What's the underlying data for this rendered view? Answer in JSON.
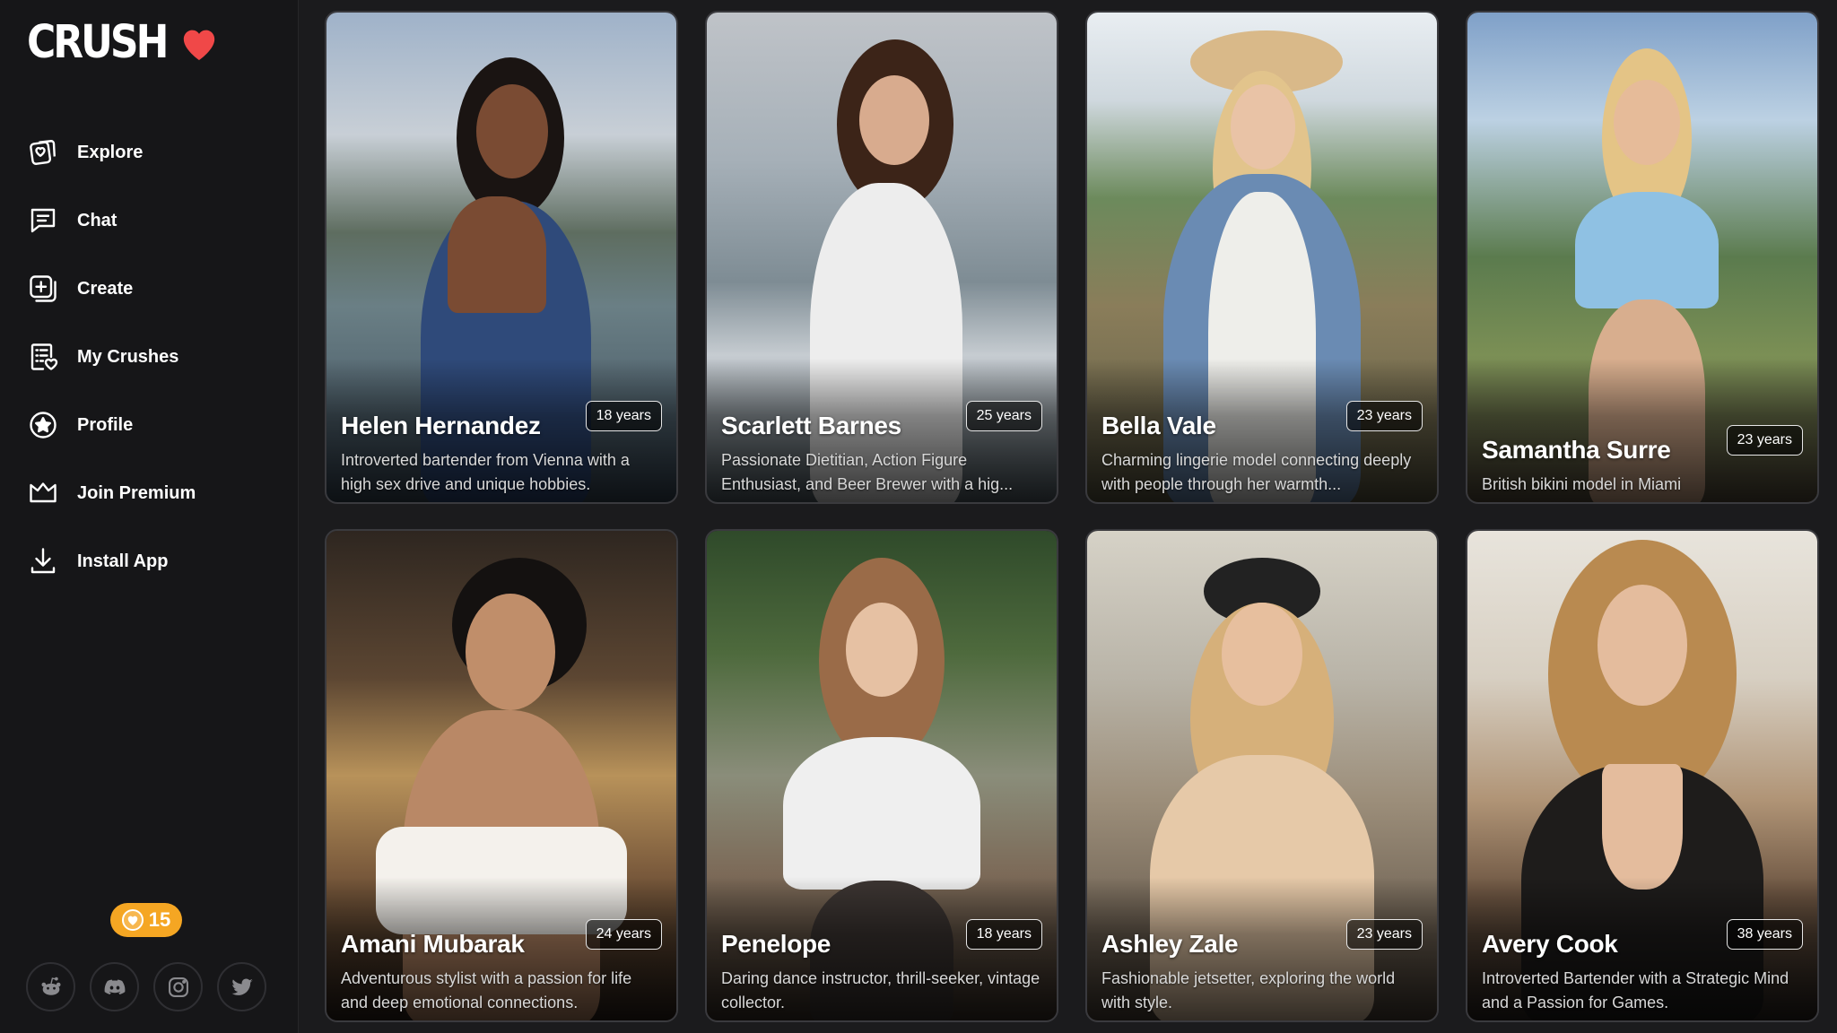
{
  "app": {
    "logo_text": "CRUSH",
    "brand_color": "#f04848"
  },
  "sidebar": {
    "items": [
      {
        "label": "Explore",
        "icon": "explore-icon"
      },
      {
        "label": "Chat",
        "icon": "chat-icon"
      },
      {
        "label": "Create",
        "icon": "create-icon"
      },
      {
        "label": "My Crushes",
        "icon": "my-crushes-icon"
      },
      {
        "label": "Profile",
        "icon": "profile-icon"
      },
      {
        "label": "Join Premium",
        "icon": "crown-icon"
      },
      {
        "label": "Install App",
        "icon": "download-icon"
      }
    ],
    "coins": "15",
    "coin_color": "#f5a623",
    "socials": [
      "reddit-icon",
      "discord-icon",
      "instagram-icon",
      "twitter-icon"
    ]
  },
  "cards": [
    {
      "name": "Helen Hernandez",
      "age": "18 years",
      "description": "Introverted bartender from Vienna with a high sex drive and unique hobbies."
    },
    {
      "name": "Scarlett Barnes",
      "age": "25 years",
      "description": "Passionate Dietitian, Action Figure Enthusiast, and Beer Brewer with a hig..."
    },
    {
      "name": "Bella Vale",
      "age": "23 years",
      "description": "Charming lingerie model connecting deeply with people through her warmth..."
    },
    {
      "name": "Samantha Surre",
      "age": "23 years",
      "description": "British bikini model in Miami"
    },
    {
      "name": "Amani Mubarak",
      "age": "24 years",
      "description": "Adventurous stylist with a passion for life and deep emotional connections."
    },
    {
      "name": "Penelope",
      "age": "18 years",
      "description": "Daring dance instructor, thrill-seeker, vintage collector."
    },
    {
      "name": "Ashley Zale",
      "age": "23 years",
      "description": "Fashionable jetsetter, exploring the world with style."
    },
    {
      "name": "Avery Cook",
      "age": "38 years",
      "description": "Introverted Bartender with a Strategic Mind and a Passion for Games."
    }
  ]
}
